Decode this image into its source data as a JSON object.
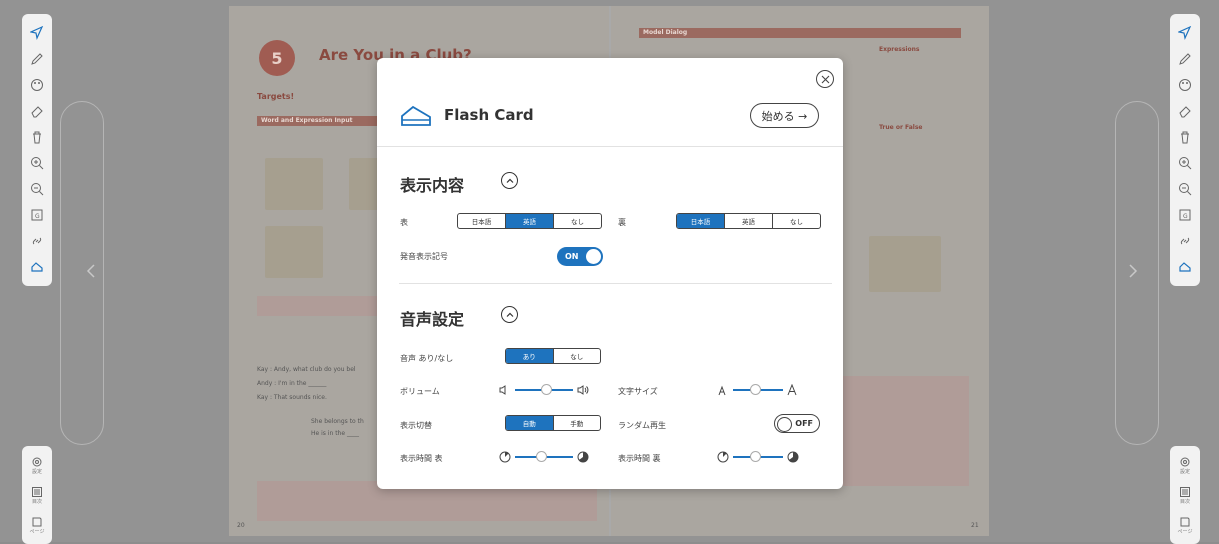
{
  "modal": {
    "title": "Flash Card",
    "start_label": "始める →",
    "display_section": {
      "title": "表示内容",
      "front_label": "表",
      "front_options": [
        "日本語",
        "英語",
        "なし"
      ],
      "front_selected": "英語",
      "back_label": "裏",
      "back_options": [
        "日本語",
        "英語",
        "なし"
      ],
      "back_selected": "日本語",
      "phonetic_label": "発音表示記号",
      "phonetic_value": "ON"
    },
    "audio_section": {
      "title": "音声設定",
      "audio_label": "音声 あり/なし",
      "audio_options": [
        "あり",
        "なし"
      ],
      "audio_selected": "あり",
      "volume_label": "ボリューム",
      "volume_level": 0.55,
      "text_size_label": "文字サイズ",
      "text_size_level": 0.45,
      "switch_label": "表示切替",
      "switch_options": [
        "自動",
        "手動"
      ],
      "switch_selected": "自動",
      "random_label": "ランダム再生",
      "random_value": "OFF",
      "front_time_label": "表示時間 表",
      "front_time_level": 0.45,
      "back_time_label": "表示時間 裏",
      "back_time_level": 0.45
    }
  },
  "book": {
    "lesson_number": "5",
    "lesson_title": "Are You in a Club?",
    "targets_label": "Targets!",
    "section_word": "Word and Expression Input",
    "model_dialog": "Model Dialog",
    "expressions": "Expressions",
    "true_false": "True or False",
    "page_left": "20",
    "page_right": "21"
  },
  "toolbar": {
    "icons": [
      "select-icon",
      "pen-icon",
      "palette-icon",
      "eraser-icon",
      "trash-icon",
      "zoom-in-icon",
      "zoom-out-icon",
      "grammar-icon",
      "link-icon",
      "flash-card-icon"
    ],
    "bottom": [
      {
        "icon": "settings-icon",
        "label": "設定"
      },
      {
        "icon": "contents-icon",
        "label": "目次"
      },
      {
        "icon": "page-icon",
        "label": "ページ"
      }
    ]
  },
  "colors": {
    "accent": "#1e73be",
    "overlay": "#939393"
  }
}
